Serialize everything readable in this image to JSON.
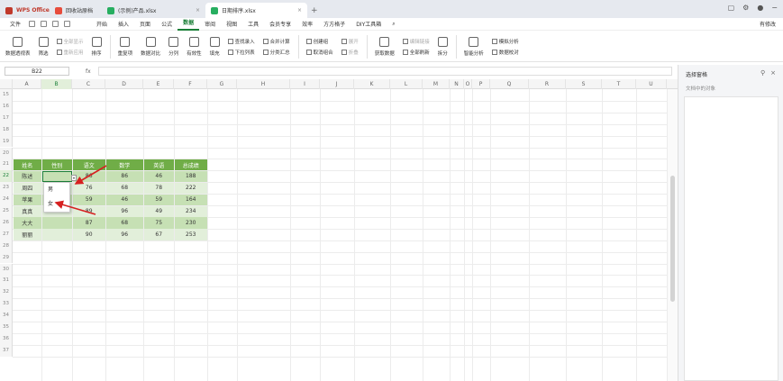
{
  "tabs": {
    "home": "WPS Office",
    "t1": "回收站原档",
    "t2": "(示例)产品.xlsx",
    "t3": "日期排序.xlsx",
    "add": "+"
  },
  "menu": {
    "file": "文件",
    "items": [
      "开始",
      "插入",
      "页面",
      "公式",
      "数据",
      "审阅",
      "视图",
      "工具",
      "会员专享",
      "效率",
      "方方格子",
      "DIY工具箱"
    ],
    "active_index": 4,
    "share": "有修改"
  },
  "ribbon": {
    "pivot": "数据透视表",
    "filter": "筛选",
    "filter_all": "全部显示",
    "reapply": "重新应用",
    "sort": "排序",
    "duplicates": "重复项",
    "compare": "数据对比",
    "split": "分列",
    "validity": "有效性",
    "fill": "填充",
    "lookup": "查找录入",
    "merge_calc": "合并计算",
    "dropdown_list": "下拉列表",
    "subtotal": "分类汇总",
    "create_group": "创建组",
    "ungroup": "取消组合",
    "expand": "展开",
    "collapse": "折叠",
    "get_data": "获取数据",
    "refresh_all": "全部刷新",
    "edit_links": "编辑链接",
    "goal": "拆分",
    "analysis": "智能分析",
    "sim_analysis": "模拟分析",
    "record_check": "数据校对"
  },
  "formula_bar": {
    "cell_ref": "B22",
    "fx": "fx",
    "value": ""
  },
  "columns": [
    "A",
    "B",
    "C",
    "D",
    "E",
    "F",
    "G",
    "H",
    "I",
    "J",
    "K",
    "L",
    "M",
    "N",
    "O",
    "P",
    "Q",
    "R",
    "S",
    "T",
    "U"
  ],
  "rows": [
    "15",
    "16",
    "17",
    "18",
    "19",
    "20",
    "21",
    "22",
    "23",
    "24",
    "25",
    "26",
    "27",
    "28",
    "29",
    "30",
    "31",
    "32",
    "33",
    "34",
    "35",
    "36",
    "37"
  ],
  "table": {
    "headers": [
      "姓名",
      "性别",
      "语文",
      "数学",
      "英语",
      "总成绩"
    ],
    "rows": [
      [
        "陈述",
        "",
        "86",
        "86",
        "46",
        "188"
      ],
      [
        "周四",
        "",
        "76",
        "68",
        "78",
        "222"
      ],
      [
        "苹果",
        "",
        "59",
        "46",
        "59",
        "164"
      ],
      [
        "真真",
        "",
        "89",
        "96",
        "49",
        "234"
      ],
      [
        "大大",
        "",
        "87",
        "68",
        "75",
        "230"
      ],
      [
        "丽丽",
        "",
        "90",
        "96",
        "67",
        "253"
      ]
    ]
  },
  "dropdown": {
    "options": [
      "男",
      "女"
    ]
  },
  "panel": {
    "title": "选择窗格",
    "subtitle": "文档中的对象"
  },
  "colors": {
    "header_green": "#70ad47",
    "band_dark": "#c6e0b4",
    "band_light": "#e2efda",
    "accent": "#1a7f37",
    "arrow": "#d62020"
  }
}
